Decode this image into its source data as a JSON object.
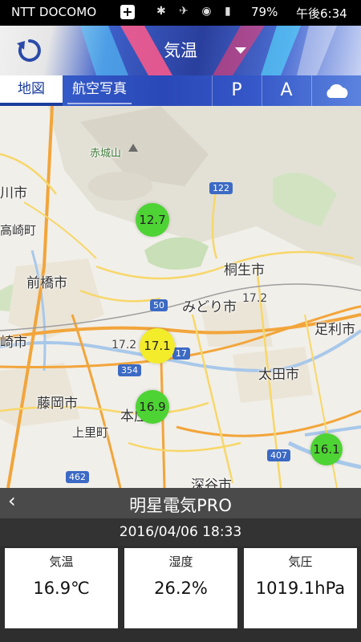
{
  "status": {
    "carrier": "NTT DOCOMO",
    "battery": "79%",
    "time": "午後6:34"
  },
  "toolbar": {
    "title": "気温",
    "refresh_icon": "refresh-icon",
    "dropdown_icon": "caret-down-icon"
  },
  "tabs": {
    "map": "地図",
    "aerial": "航空写真",
    "p": "P",
    "a": "A",
    "cloud_icon": "cloud-icon"
  },
  "map": {
    "places": {
      "akagi": "赤城山",
      "kawa": "川市",
      "takasaki": "高崎町",
      "maebashi": "前橋市",
      "kiryu": "桐生市",
      "midori": "みどり市",
      "ashikaga": "足利市",
      "isesaki": "崎市",
      "ota": "太田市",
      "fujioka": "藤岡市",
      "honjo": "本庄",
      "kamisato": "上里町",
      "fukaya": "深谷市"
    },
    "routes": {
      "r122": "122",
      "r50": "50",
      "r17": "17",
      "r354": "354",
      "r407": "407",
      "r462": "462"
    },
    "markers": [
      {
        "value": "12.7",
        "color": "green"
      },
      {
        "value": "17.1",
        "color": "yellow"
      },
      {
        "value": "16.9",
        "color": "green"
      },
      {
        "value": "16.1",
        "color": "green"
      }
    ],
    "labels": {
      "kiryu_temp": "17.2",
      "isesaki_temp": "17.2"
    }
  },
  "station": {
    "name": "明星電気PRO",
    "datetime": "2016/04/06 18:33"
  },
  "readings": {
    "temp_label": "気温",
    "temp_value": "16.9℃",
    "humidity_label": "湿度",
    "humidity_value": "26.2%",
    "pressure_label": "気圧",
    "pressure_value": "1019.1hPa"
  }
}
